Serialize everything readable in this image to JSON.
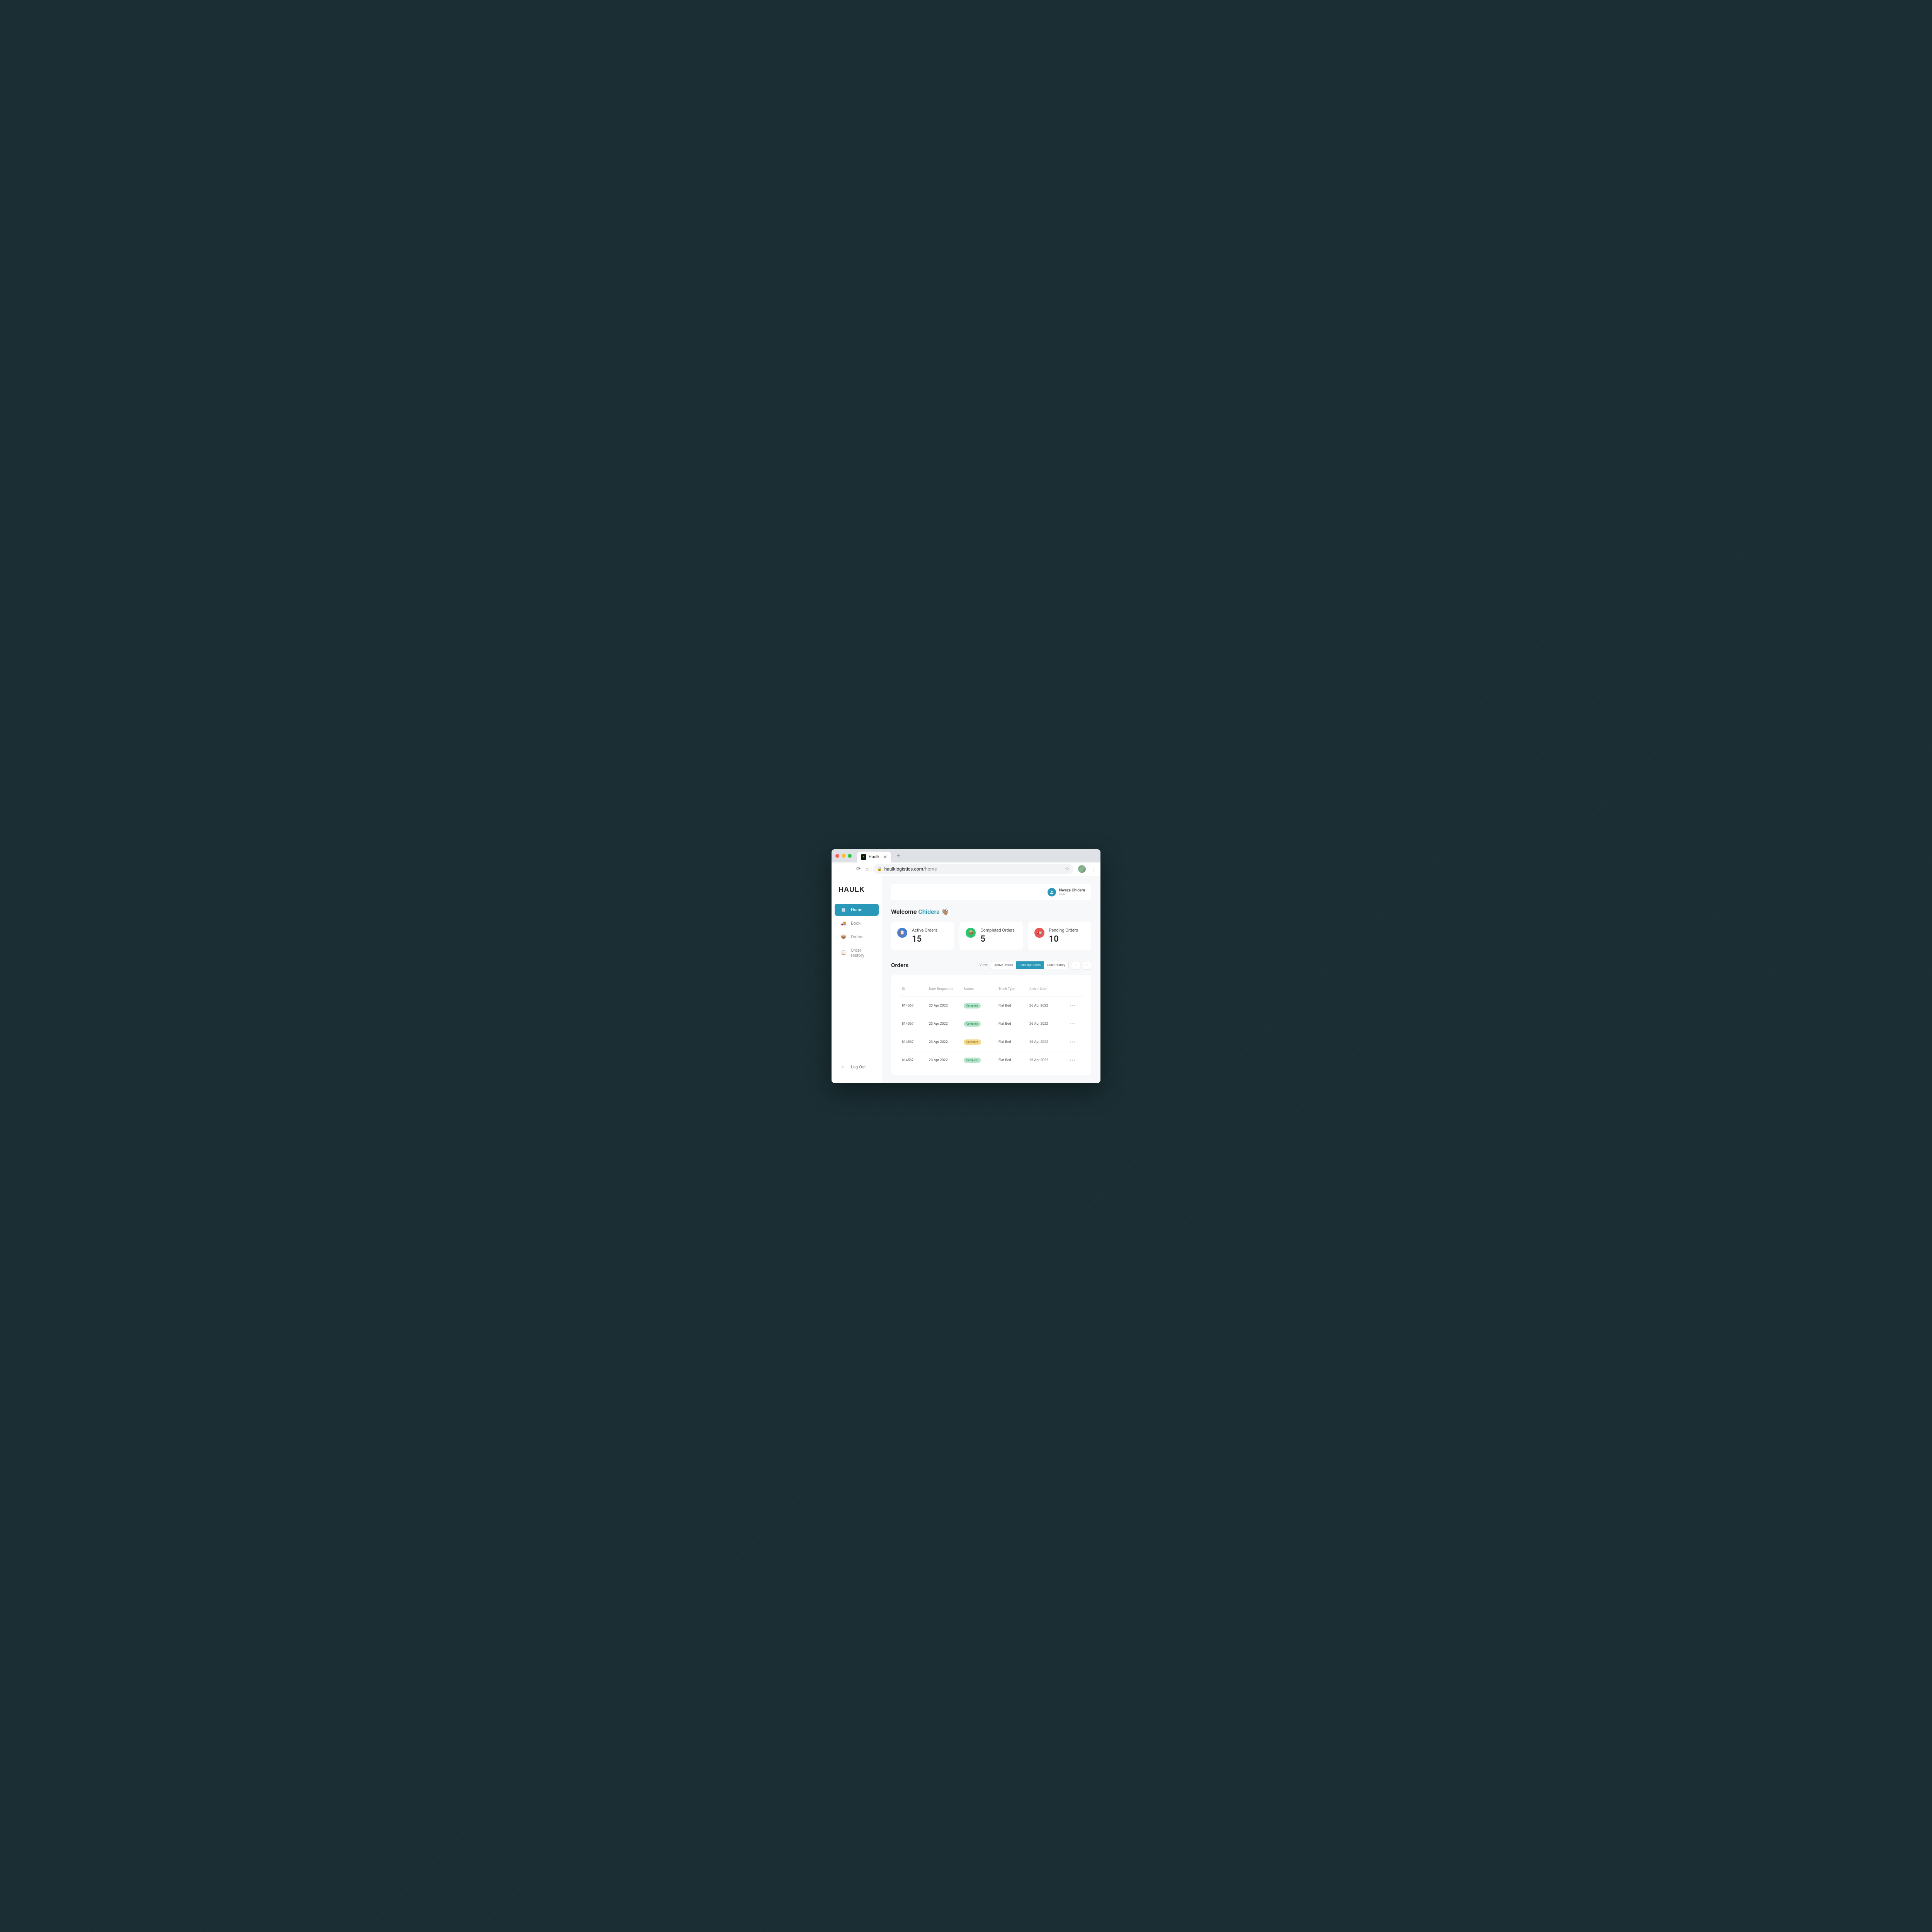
{
  "browser": {
    "tab_title": "Haulk",
    "url_domain": "haulklogistics.com",
    "url_path": "/home"
  },
  "brand": {
    "logo_text": "HAULK"
  },
  "sidebar": {
    "items": [
      {
        "label": "Home",
        "active": true
      },
      {
        "label": "Book",
        "active": false
      },
      {
        "label": "Orders",
        "active": false
      },
      {
        "label": "Order History",
        "active": false
      }
    ],
    "logout_label": "Log Out"
  },
  "header": {
    "user_name": "Nweze Chidera",
    "user_role": "User"
  },
  "welcome": {
    "prefix": "Welcome ",
    "name": "Chidera",
    "emoji": "👋🏽"
  },
  "stats": [
    {
      "label": "Active Orders",
      "value": "15",
      "color": "blue"
    },
    {
      "label": "Completed Orders",
      "value": "5",
      "color": "green"
    },
    {
      "label": "Pending Orders",
      "value": "10",
      "color": "red"
    }
  ],
  "orders_section": {
    "title": "Orders",
    "view_label": "View:",
    "filters": [
      {
        "label": "Active Orders",
        "active": false
      },
      {
        "label": "Pending Orders",
        "active": true
      },
      {
        "label": "Order History",
        "active": false
      }
    ]
  },
  "table": {
    "columns": [
      "ID",
      "Date Requested",
      "Status",
      "Truck Type",
      "Arrival Date"
    ],
    "rows": [
      {
        "id": "814567",
        "date_requested": "23 Apr 2022",
        "status": "Complete",
        "status_type": "complete",
        "truck_type": "Flat Bed",
        "arrival_date": "26 Apr 2022"
      },
      {
        "id": "814567",
        "date_requested": "23 Apr 2022",
        "status": "Complete",
        "status_type": "complete",
        "truck_type": "Flat Bed",
        "arrival_date": "26 Apr 2022"
      },
      {
        "id": "814567",
        "date_requested": "23 Apr 2022",
        "status": "Cancelled",
        "status_type": "cancelled",
        "truck_type": "Flat Bed",
        "arrival_date": "26 Apr 2022"
      },
      {
        "id": "814567",
        "date_requested": "23 Apr 2022",
        "status": "Complete",
        "status_type": "complete",
        "truck_type": "Flat Bed",
        "arrival_date": "26 Apr 2022"
      }
    ]
  }
}
